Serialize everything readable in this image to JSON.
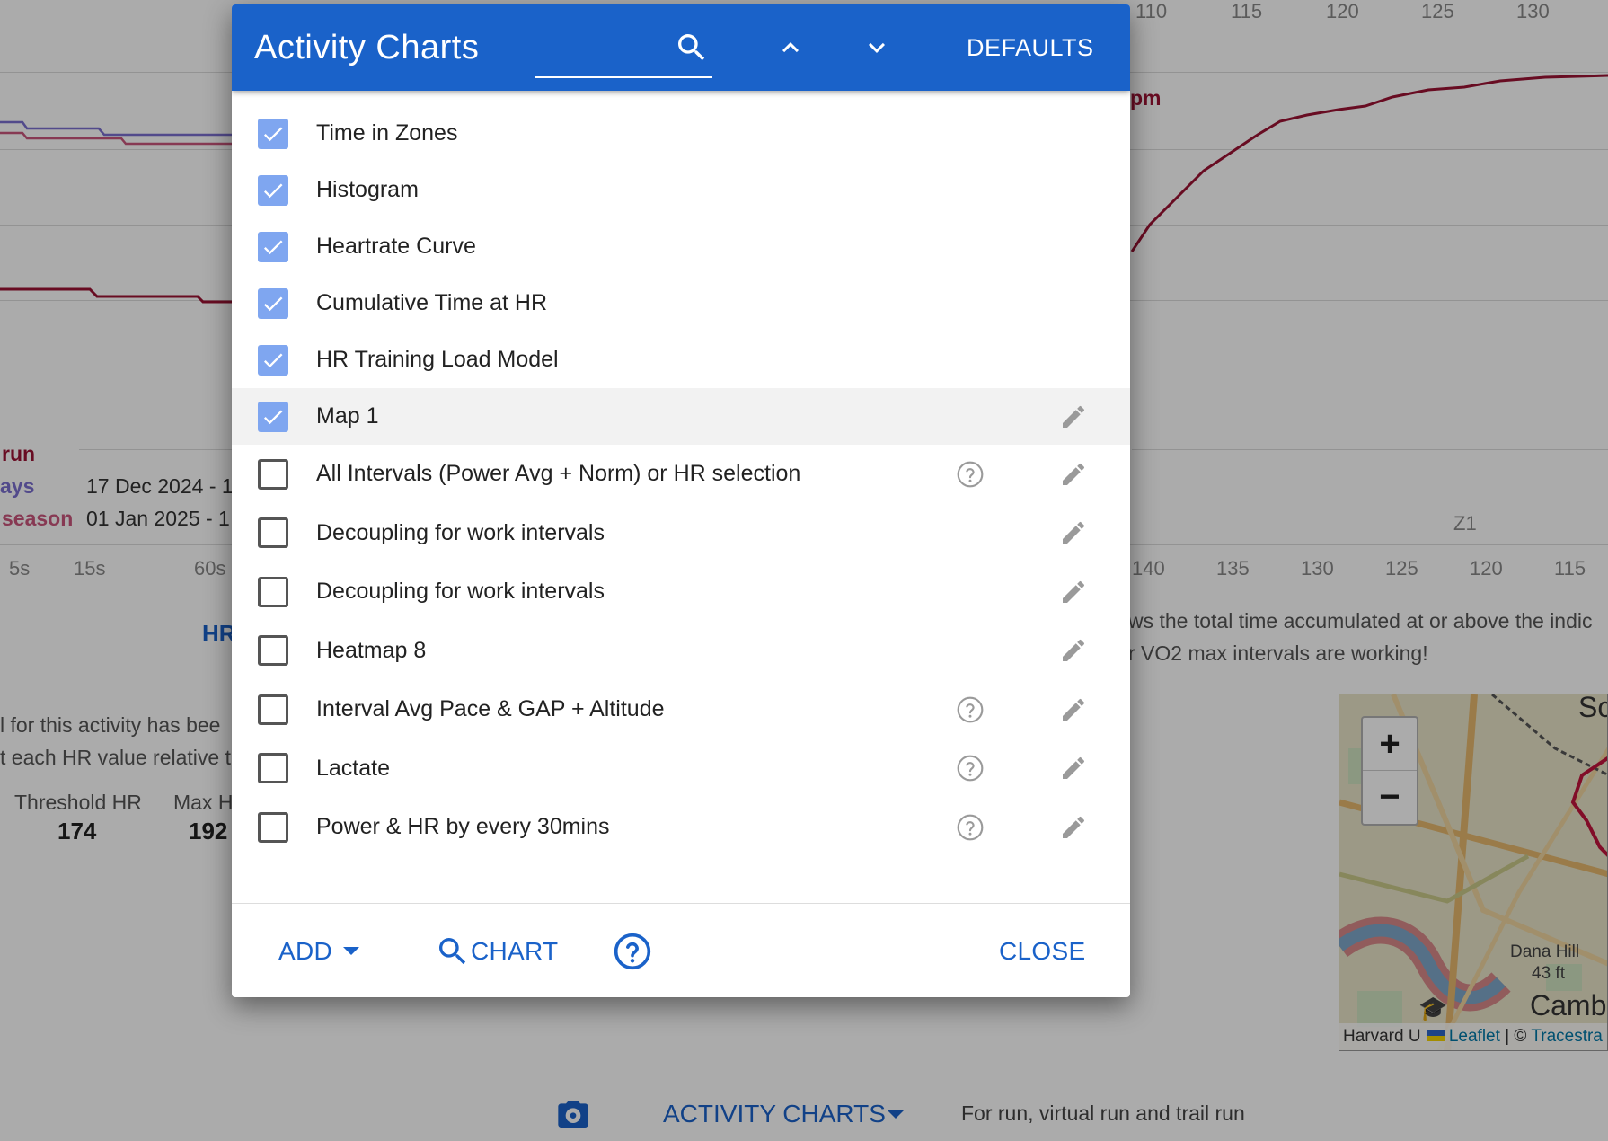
{
  "background": {
    "top_axis_ticks": [
      "110",
      "115",
      "120",
      "125",
      "130"
    ],
    "left_legend": {
      "items": [
        {
          "name": "run",
          "date": ""
        },
        {
          "name": "ays",
          "date": "17 Dec 2024 - 1"
        },
        {
          "name": "season",
          "date": "01 Jan 2025 - 1"
        }
      ]
    },
    "left_x_ticks": [
      "5s",
      "15s",
      "60s"
    ],
    "left_chart_title": "HR",
    "right_series_label": "pm",
    "right_zone_label": "Z1",
    "right_x_ticks": [
      "140",
      "135",
      "130",
      "125",
      "120",
      "115"
    ],
    "right_desc_lines": [
      "ws the total time accumulated at or above the indic",
      "r VO2 max intervals are working!"
    ],
    "left_desc_lines": [
      "l for this activity has bee",
      "t each HR value relative t"
    ],
    "stats": [
      {
        "label": "Threshold HR",
        "value": "174"
      },
      {
        "label": "Max H",
        "value": "192"
      }
    ],
    "map": {
      "zoom_in": "+",
      "zoom_out": "−",
      "label_place": "Dana Hill",
      "label_elev": "43 ft",
      "label_town": "Camb",
      "label_corner": "Sc",
      "attrib_left": "Harvard U",
      "attrib_leaflet": "Leaflet",
      "attrib_sep": "| ©",
      "attrib_right": "Tracestra"
    },
    "bottom_bar": {
      "charts_label": "ACTIVITY CHARTS",
      "note": "For run, virtual run and trail run"
    }
  },
  "dialog": {
    "title": "Activity Charts",
    "search": {
      "value": "",
      "placeholder": ""
    },
    "defaults_label": "DEFAULTS",
    "items": [
      {
        "label": "Time in Zones",
        "checked": true,
        "help": false,
        "edit": false
      },
      {
        "label": "Histogram",
        "checked": true,
        "help": false,
        "edit": false
      },
      {
        "label": "Heartrate Curve",
        "checked": true,
        "help": false,
        "edit": false
      },
      {
        "label": "Cumulative Time at HR",
        "checked": true,
        "help": false,
        "edit": false
      },
      {
        "label": "HR Training Load Model",
        "checked": true,
        "help": false,
        "edit": false
      },
      {
        "label": "Map 1",
        "checked": true,
        "help": false,
        "edit": true
      },
      {
        "label": "All Intervals (Power Avg + Norm) or HR selection",
        "checked": false,
        "help": true,
        "edit": true
      },
      {
        "label": "Decoupling for work intervals",
        "checked": false,
        "help": false,
        "edit": true
      },
      {
        "label": "Decoupling for work intervals",
        "checked": false,
        "help": false,
        "edit": true
      },
      {
        "label": "Heatmap 8",
        "checked": false,
        "help": false,
        "edit": true
      },
      {
        "label": "Interval Avg Pace & GAP + Altitude",
        "checked": false,
        "help": true,
        "edit": true
      },
      {
        "label": "Lactate",
        "checked": false,
        "help": true,
        "edit": true
      },
      {
        "label": "Power & HR by every 30mins",
        "checked": false,
        "help": true,
        "edit": true
      }
    ],
    "footer": {
      "add_label": "ADD",
      "chart_label": "CHART",
      "close_label": "CLOSE"
    }
  },
  "colors": {
    "primary": "#1a62c9",
    "checkbox_checked": "#7fa6f0",
    "hr_line": "#9b1234",
    "purple_line": "#7b6fd0",
    "pink_line": "#c9567c"
  }
}
